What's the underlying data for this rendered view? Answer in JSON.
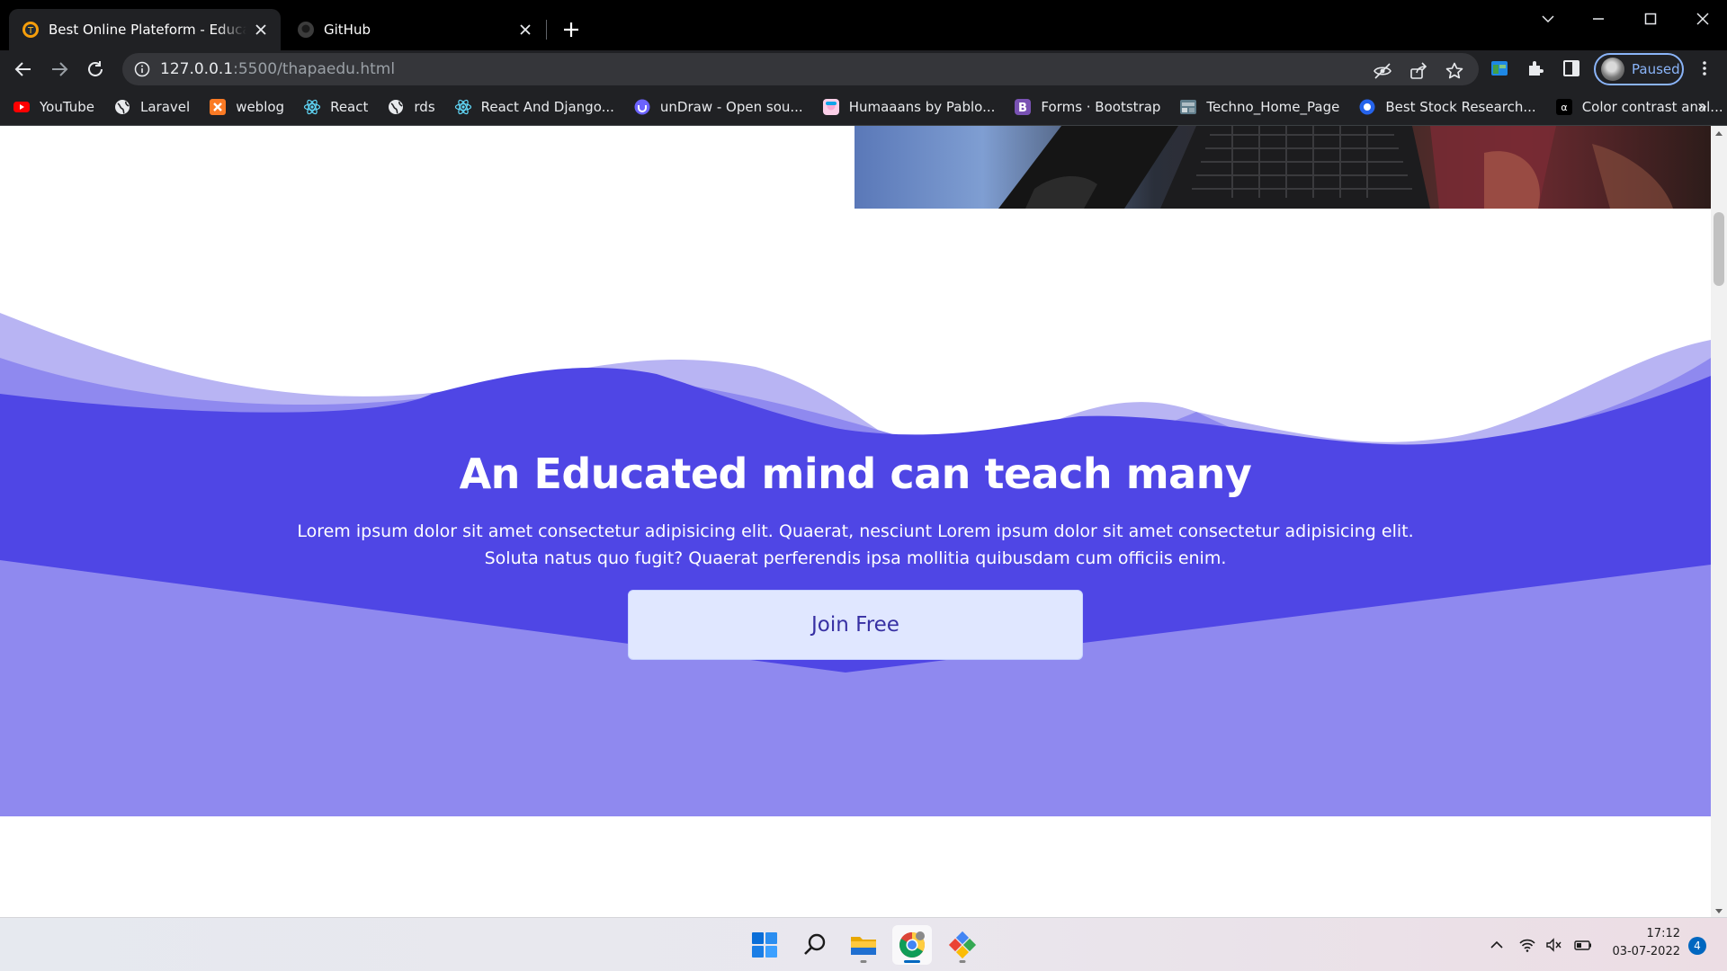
{
  "browser": {
    "tabs": [
      {
        "title": "Best Online Plateform - Education",
        "active": true
      },
      {
        "title": "GitHub",
        "active": false
      }
    ],
    "url": {
      "host": "127.0.0.1",
      "rest": ":5500/thapaedu.html"
    },
    "profile_label": "Paused",
    "bookmarks": [
      {
        "label": "YouTube",
        "icon": "youtube-icon"
      },
      {
        "label": "Laravel",
        "icon": "globe-icon"
      },
      {
        "label": "weblog",
        "icon": "xampp-icon"
      },
      {
        "label": "React",
        "icon": "react-icon"
      },
      {
        "label": "rds",
        "icon": "globe-icon"
      },
      {
        "label": "React And Django...",
        "icon": "react-icon"
      },
      {
        "label": "unDraw - Open sou...",
        "icon": "undraw-icon"
      },
      {
        "label": "Humaaans by Pablo...",
        "icon": "humaaans-icon"
      },
      {
        "label": "Forms · Bootstrap",
        "icon": "bootstrap-icon"
      },
      {
        "label": "Techno_Home_Page",
        "icon": "techno-icon"
      },
      {
        "label": "Best Stock Research...",
        "icon": "stock-icon"
      },
      {
        "label": "Color contrast anal...",
        "icon": "contrast-icon"
      }
    ],
    "bookmarks_more": "»"
  },
  "page": {
    "cta": {
      "title": "An Educated mind can teach many",
      "text": "Lorem ipsum dolor sit amet consectetur adipisicing elit. Quaerat, nesciunt Lorem ipsum dolor sit amet consectetur adipisicing elit. Soluta natus quo fugit? Quaerat perferendis ipsa mollitia quibusdam cum officiis enim.",
      "button_label": "Join Free"
    }
  },
  "taskbar": {
    "time": "17:12",
    "date": "03-07-2022",
    "notification_count": "4"
  },
  "colors": {
    "brand_purple": "#4f46e5",
    "wave_light": "#b8b4f3",
    "button_bg": "#e0e7ff",
    "button_text": "#3730a3"
  }
}
